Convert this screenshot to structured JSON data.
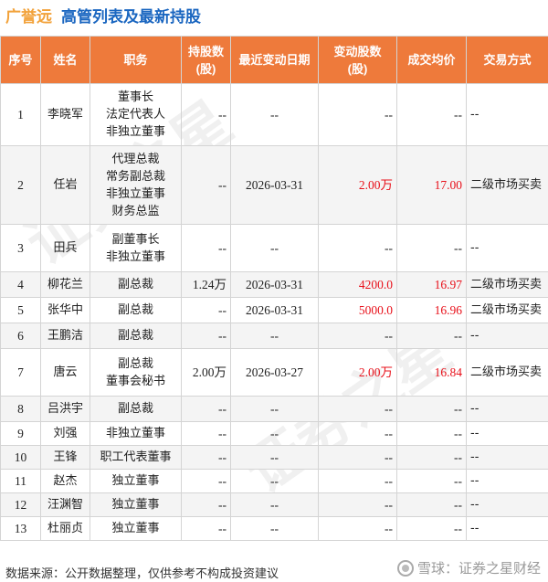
{
  "title": {
    "company": "广誉远",
    "rest": "高管列表及最新持股"
  },
  "columns": [
    "序号",
    "姓名",
    "职务",
    "持股数\n(股)",
    "最近变动日期",
    "变动股数\n(股)",
    "成交均价",
    "交易方式"
  ],
  "rows": [
    {
      "no": "1",
      "name": "李晓军",
      "roles": [
        "董事长",
        "法定代表人",
        "非独立董事"
      ],
      "shares": "--",
      "date": "--",
      "change": "--",
      "price": "--",
      "method": "--"
    },
    {
      "no": "2",
      "name": "任岩",
      "roles": [
        "代理总裁",
        "常务副总裁",
        "非独立董事",
        "财务总监"
      ],
      "shares": "--",
      "date": "2026-03-31",
      "change": "2.00万",
      "price": "17.00",
      "method": "二级市场买卖"
    },
    {
      "no": "3",
      "name": "田兵",
      "roles": [
        "副董事长",
        "非独立董事"
      ],
      "shares": "--",
      "date": "--",
      "change": "--",
      "price": "--",
      "method": "--"
    },
    {
      "no": "4",
      "name": "柳花兰",
      "roles": [
        "副总裁"
      ],
      "shares": "1.24万",
      "date": "2026-03-31",
      "change": "4200.0",
      "price": "16.97",
      "method": "二级市场买卖"
    },
    {
      "no": "5",
      "name": "张华中",
      "roles": [
        "副总裁"
      ],
      "shares": "--",
      "date": "2026-03-31",
      "change": "5000.0",
      "price": "16.96",
      "method": "二级市场买卖"
    },
    {
      "no": "6",
      "name": "王鹏洁",
      "roles": [
        "副总裁"
      ],
      "shares": "--",
      "date": "--",
      "change": "--",
      "price": "--",
      "method": "--"
    },
    {
      "no": "7",
      "name": "唐云",
      "roles": [
        "副总裁",
        "董事会秘书"
      ],
      "shares": "2.00万",
      "date": "2026-03-27",
      "change": "2.00万",
      "price": "16.84",
      "method": "二级市场买卖"
    },
    {
      "no": "8",
      "name": "吕洪宇",
      "roles": [
        "副总裁"
      ],
      "shares": "--",
      "date": "--",
      "change": "--",
      "price": "--",
      "method": "--"
    },
    {
      "no": "9",
      "name": "刘强",
      "roles": [
        "非独立董事"
      ],
      "shares": "--",
      "date": "--",
      "change": "--",
      "price": "--",
      "method": "--"
    },
    {
      "no": "10",
      "name": "王锋",
      "roles": [
        "职工代表董事"
      ],
      "shares": "--",
      "date": "--",
      "change": "--",
      "price": "--",
      "method": "--"
    },
    {
      "no": "11",
      "name": "赵杰",
      "roles": [
        "独立董事"
      ],
      "shares": "--",
      "date": "--",
      "change": "--",
      "price": "--",
      "method": "--"
    },
    {
      "no": "12",
      "name": "汪渊智",
      "roles": [
        "独立董事"
      ],
      "shares": "--",
      "date": "--",
      "change": "--",
      "price": "--",
      "method": "--"
    },
    {
      "no": "13",
      "name": "杜丽贞",
      "roles": [
        "独立董事"
      ],
      "shares": "--",
      "date": "--",
      "change": "--",
      "price": "--",
      "method": "--"
    }
  ],
  "footer": "数据来源：公开数据整理，仅供参考不构成投资建议",
  "brand": "雪球：证券之星财经",
  "colors": {
    "header": "#ee7a3b",
    "company": "#f2a23a",
    "title": "#1a66c0",
    "positive": "#e8101a"
  }
}
